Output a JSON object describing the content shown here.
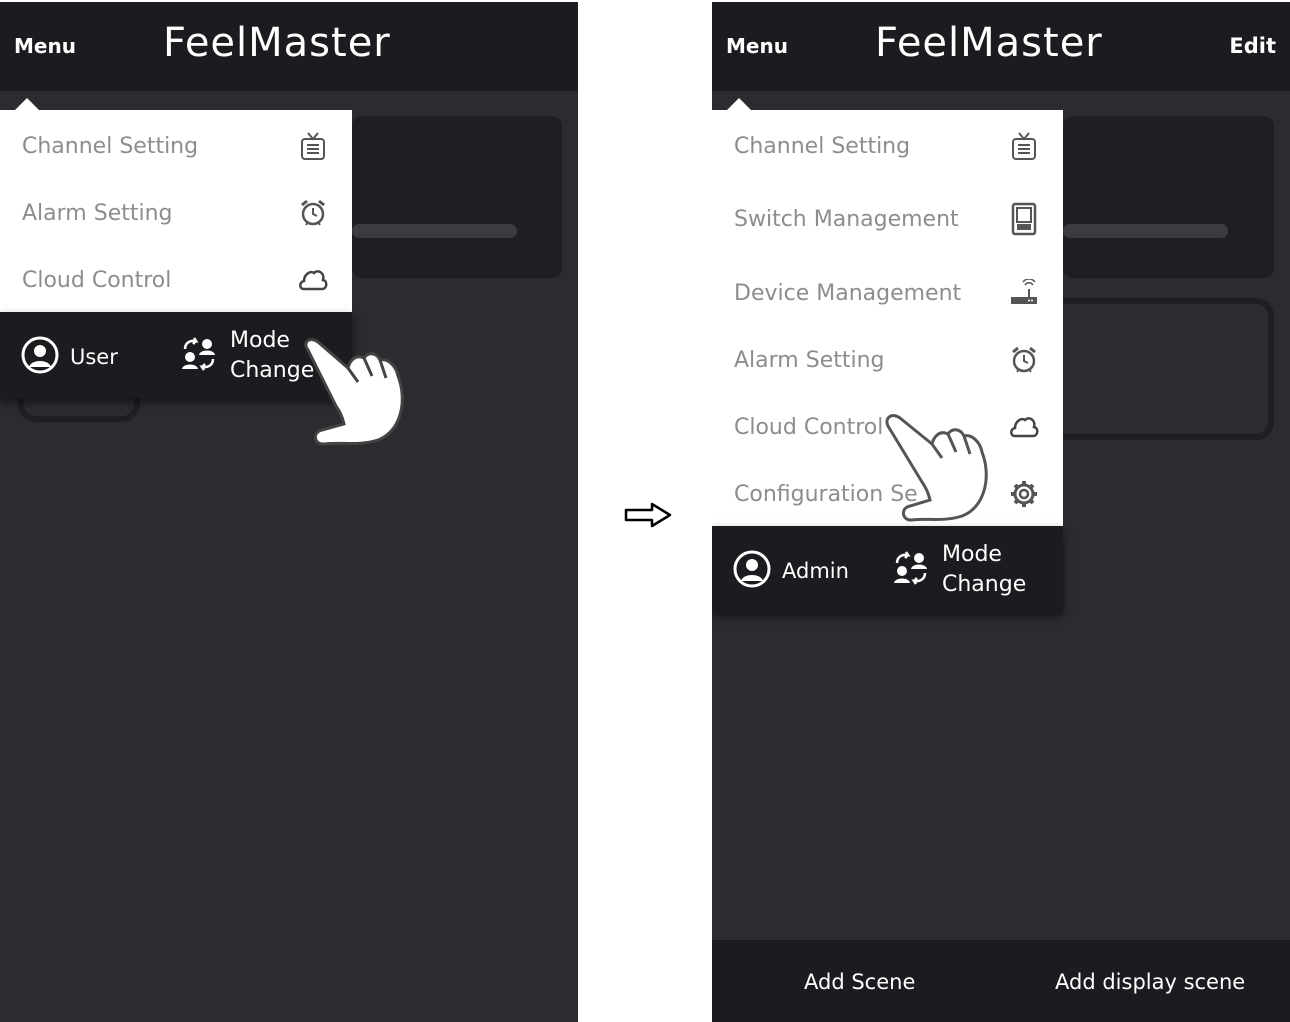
{
  "left_screen": {
    "menu_label": "Menu",
    "app_title": "FeelMaster",
    "menu_items": [
      {
        "label": "Channel Setting",
        "icon": "tv-icon"
      },
      {
        "label": "Alarm Setting",
        "icon": "alarm-clock-icon"
      },
      {
        "label": "Cloud Control",
        "icon": "cloud-icon"
      }
    ],
    "role_label": "User",
    "mode_change_line1": "Mode",
    "mode_change_line2": "Change"
  },
  "right_screen": {
    "menu_label": "Menu",
    "app_title": "FeelMaster",
    "edit_label": "Edit",
    "menu_items": [
      {
        "label": "Channel Setting",
        "icon": "tv-icon"
      },
      {
        "label": "Switch Management",
        "icon": "switch-icon"
      },
      {
        "label": "Device Management",
        "icon": "router-icon"
      },
      {
        "label": "Alarm Setting",
        "icon": "alarm-clock-icon"
      },
      {
        "label": "Cloud Control",
        "icon": "cloud-icon"
      },
      {
        "label": "Configuration Se",
        "icon": "gear-icon"
      }
    ],
    "role_label": "Admin",
    "mode_change_line1": "Mode",
    "mode_change_line2": "Change",
    "bottom_actions": [
      "Add Scene",
      "Add display scene"
    ]
  },
  "colors": {
    "background": "#2b2b30",
    "topbar": "#1c1c20",
    "menu_text": "#8d8d8d",
    "dropdown": "#ffffff"
  }
}
